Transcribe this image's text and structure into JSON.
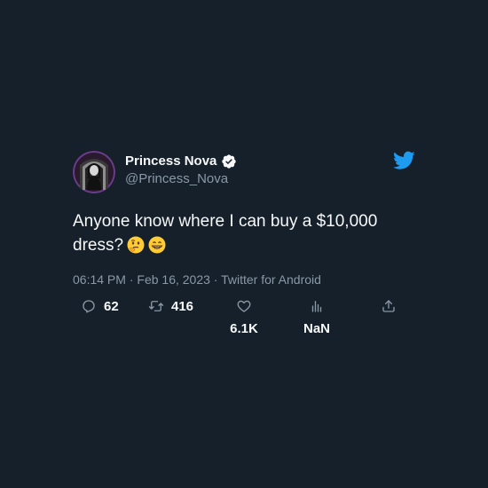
{
  "author": {
    "display_name": "Princess Nova",
    "handle": "@Princess_Nova",
    "verified": true
  },
  "tweet": {
    "text": "Anyone know where I can buy a $10,000 dress?",
    "emojis": [
      "thinking-face",
      "grinning-face-with-big-eyes"
    ],
    "time": "06:14 PM",
    "date": "Feb 16, 2023",
    "source": "Twitter for Android",
    "separator": "·"
  },
  "actions": {
    "replies": "62",
    "retweets": "416",
    "likes": "6.1K",
    "views": "NaN"
  },
  "icons": {
    "verified": "verified-badge-icon",
    "brand": "twitter-bird-icon",
    "reply": "reply-icon",
    "retweet": "retweet-icon",
    "like": "heart-icon",
    "views": "views-icon",
    "share": "share-icon"
  },
  "colors": {
    "background": "#15202b",
    "primary_text": "#f7f9f9",
    "secondary_text": "#8b98a5",
    "brand_blue": "#1d9bf0",
    "emoji_yellow": "#ffcc33"
  }
}
